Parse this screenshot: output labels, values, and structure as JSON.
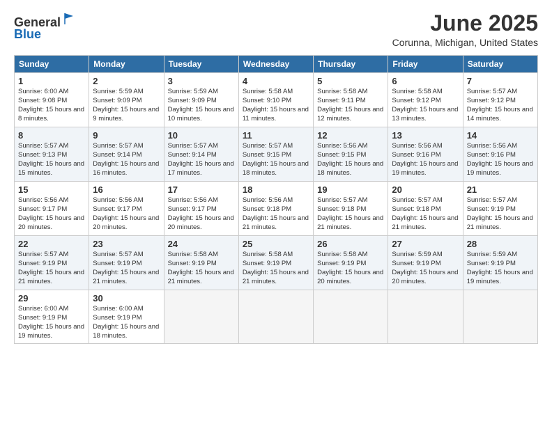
{
  "logo": {
    "general": "General",
    "blue": "Blue"
  },
  "title": "June 2025",
  "subtitle": "Corunna, Michigan, United States",
  "days_of_week": [
    "Sunday",
    "Monday",
    "Tuesday",
    "Wednesday",
    "Thursday",
    "Friday",
    "Saturday"
  ],
  "weeks": [
    [
      {
        "day": "1",
        "sunrise": "6:00 AM",
        "sunset": "9:08 PM",
        "daylight": "15 hours and 8 minutes."
      },
      {
        "day": "2",
        "sunrise": "5:59 AM",
        "sunset": "9:09 PM",
        "daylight": "15 hours and 9 minutes."
      },
      {
        "day": "3",
        "sunrise": "5:59 AM",
        "sunset": "9:09 PM",
        "daylight": "15 hours and 10 minutes."
      },
      {
        "day": "4",
        "sunrise": "5:58 AM",
        "sunset": "9:10 PM",
        "daylight": "15 hours and 11 minutes."
      },
      {
        "day": "5",
        "sunrise": "5:58 AM",
        "sunset": "9:11 PM",
        "daylight": "15 hours and 12 minutes."
      },
      {
        "day": "6",
        "sunrise": "5:58 AM",
        "sunset": "9:12 PM",
        "daylight": "15 hours and 13 minutes."
      },
      {
        "day": "7",
        "sunrise": "5:57 AM",
        "sunset": "9:12 PM",
        "daylight": "15 hours and 14 minutes."
      }
    ],
    [
      {
        "day": "8",
        "sunrise": "5:57 AM",
        "sunset": "9:13 PM",
        "daylight": "15 hours and 15 minutes."
      },
      {
        "day": "9",
        "sunrise": "5:57 AM",
        "sunset": "9:14 PM",
        "daylight": "15 hours and 16 minutes."
      },
      {
        "day": "10",
        "sunrise": "5:57 AM",
        "sunset": "9:14 PM",
        "daylight": "15 hours and 17 minutes."
      },
      {
        "day": "11",
        "sunrise": "5:57 AM",
        "sunset": "9:15 PM",
        "daylight": "15 hours and 18 minutes."
      },
      {
        "day": "12",
        "sunrise": "5:56 AM",
        "sunset": "9:15 PM",
        "daylight": "15 hours and 18 minutes."
      },
      {
        "day": "13",
        "sunrise": "5:56 AM",
        "sunset": "9:16 PM",
        "daylight": "15 hours and 19 minutes."
      },
      {
        "day": "14",
        "sunrise": "5:56 AM",
        "sunset": "9:16 PM",
        "daylight": "15 hours and 19 minutes."
      }
    ],
    [
      {
        "day": "15",
        "sunrise": "5:56 AM",
        "sunset": "9:17 PM",
        "daylight": "15 hours and 20 minutes."
      },
      {
        "day": "16",
        "sunrise": "5:56 AM",
        "sunset": "9:17 PM",
        "daylight": "15 hours and 20 minutes."
      },
      {
        "day": "17",
        "sunrise": "5:56 AM",
        "sunset": "9:17 PM",
        "daylight": "15 hours and 20 minutes."
      },
      {
        "day": "18",
        "sunrise": "5:56 AM",
        "sunset": "9:18 PM",
        "daylight": "15 hours and 21 minutes."
      },
      {
        "day": "19",
        "sunrise": "5:57 AM",
        "sunset": "9:18 PM",
        "daylight": "15 hours and 21 minutes."
      },
      {
        "day": "20",
        "sunrise": "5:57 AM",
        "sunset": "9:18 PM",
        "daylight": "15 hours and 21 minutes."
      },
      {
        "day": "21",
        "sunrise": "5:57 AM",
        "sunset": "9:19 PM",
        "daylight": "15 hours and 21 minutes."
      }
    ],
    [
      {
        "day": "22",
        "sunrise": "5:57 AM",
        "sunset": "9:19 PM",
        "daylight": "15 hours and 21 minutes."
      },
      {
        "day": "23",
        "sunrise": "5:57 AM",
        "sunset": "9:19 PM",
        "daylight": "15 hours and 21 minutes."
      },
      {
        "day": "24",
        "sunrise": "5:58 AM",
        "sunset": "9:19 PM",
        "daylight": "15 hours and 21 minutes."
      },
      {
        "day": "25",
        "sunrise": "5:58 AM",
        "sunset": "9:19 PM",
        "daylight": "15 hours and 21 minutes."
      },
      {
        "day": "26",
        "sunrise": "5:58 AM",
        "sunset": "9:19 PM",
        "daylight": "15 hours and 20 minutes."
      },
      {
        "day": "27",
        "sunrise": "5:59 AM",
        "sunset": "9:19 PM",
        "daylight": "15 hours and 20 minutes."
      },
      {
        "day": "28",
        "sunrise": "5:59 AM",
        "sunset": "9:19 PM",
        "daylight": "15 hours and 19 minutes."
      }
    ],
    [
      {
        "day": "29",
        "sunrise": "6:00 AM",
        "sunset": "9:19 PM",
        "daylight": "15 hours and 19 minutes."
      },
      {
        "day": "30",
        "sunrise": "6:00 AM",
        "sunset": "9:19 PM",
        "daylight": "15 hours and 18 minutes."
      },
      null,
      null,
      null,
      null,
      null
    ]
  ]
}
